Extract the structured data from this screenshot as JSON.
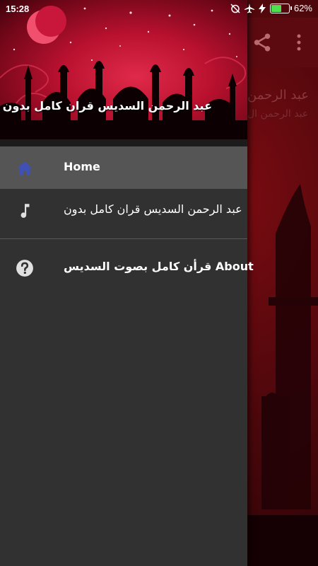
{
  "status_bar": {
    "time": "15:28",
    "battery_percent": "62%",
    "battery_level": 0.62
  },
  "background_app": {
    "title": "عبد الرحمن",
    "subtitle": "عبد الرحمن ال",
    "share_icon": "share-icon",
    "more_icon": "more-vert-icon"
  },
  "drawer": {
    "header_title": "عبد الرحمن السديس قران كامل بدون نت",
    "items": [
      {
        "label": "Home",
        "icon": "home-icon",
        "active": true
      },
      {
        "label": "عبد الرحمن السديس قران كامل بدون",
        "icon": "music-note-icon",
        "active": false
      },
      {
        "label": "قرأن كامل بصوت السديس About",
        "icon": "help-icon",
        "active": false
      }
    ]
  },
  "colors": {
    "drawer_bg": "#313131",
    "active_item_bg": "#555555",
    "home_icon": "#3f51b5",
    "header_red": "#c8153a"
  }
}
